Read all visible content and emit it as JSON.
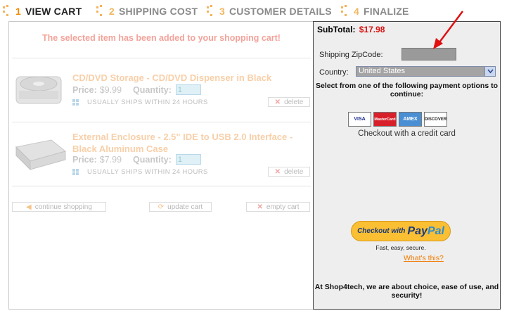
{
  "steps": [
    {
      "num": "1",
      "label": "VIEW CART"
    },
    {
      "num": "2",
      "label": "SHIPPING COST"
    },
    {
      "num": "3",
      "label": "CUSTOMER DETAILS"
    },
    {
      "num": "4",
      "label": "FINALIZE"
    }
  ],
  "cart": {
    "added_message": "The selected item has been added to your shopping cart!",
    "price_label": "Price:",
    "quantity_label": "Quantity:",
    "items": [
      {
        "title": "CD/DVD Storage - CD/DVD Dispenser in Black",
        "price": "$9.99",
        "quantity": "1",
        "ships": "USUALLY SHIPS WITHIN 24 HOURS",
        "delete_label": "delete"
      },
      {
        "title": "External Enclosure - 2.5\" IDE to USB 2.0 Interface - Black Aluminum Case",
        "price": "$7.99",
        "quantity": "1",
        "ships": "USUALLY SHIPS WITHIN 24 HOURS",
        "delete_label": "delete"
      }
    ],
    "continue_label": "continue shopping",
    "update_label": "update cart",
    "empty_label": "empty cart"
  },
  "summary": {
    "subtotal_label": "SubTotal:",
    "subtotal_value": "$17.98",
    "zip_label": "Shipping ZipCode:",
    "zip_value": "",
    "country_label": "Country:",
    "country_value": "United States",
    "payment_text": "Select from one of the following payment options to continue:",
    "cards": [
      "VISA",
      "MasterCard",
      "AMEX",
      "DISCOVER"
    ],
    "credit_card_text": "Checkout with a credit card",
    "paypal_checkout": "Checkout with",
    "paypal_pay": "Pay",
    "paypal_pal": "Pal",
    "paypal_sub": "Fast, easy, secure.",
    "whats_this": "What's this?",
    "bottom_note": "At Shop4tech, we are about choice, ease of use, and security!"
  },
  "colors": {
    "active_step": "#f08c00",
    "subtotal_value": "#d81010",
    "added_message": "#f3a39a",
    "item_title": "#f8cfa8",
    "paypal_button": "#fbbf34",
    "link": "#f07a00",
    "annotation_arrow": "#e01010"
  }
}
